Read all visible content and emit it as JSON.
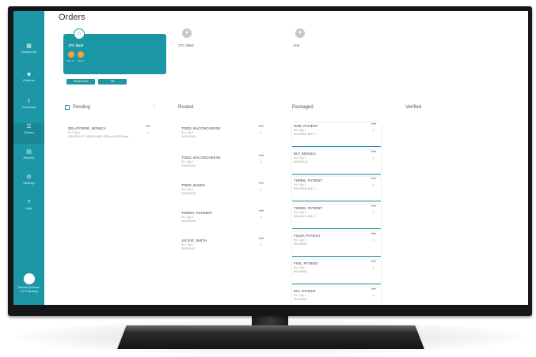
{
  "page": {
    "title": "Orders"
  },
  "nav": [
    {
      "icon": "dashboard-icon",
      "glyph": "▦",
      "label": "Dashboard"
    },
    {
      "icon": "patients-icon",
      "glyph": "☻",
      "label": "Patients"
    },
    {
      "icon": "pharmacy-icon",
      "glyph": "⚕",
      "label": "Pharmacy"
    },
    {
      "icon": "orders-icon",
      "glyph": "☰",
      "label": "Orders"
    },
    {
      "icon": "reports-icon",
      "glyph": "▤",
      "label": "Reports"
    },
    {
      "icon": "settings-icon",
      "glyph": "⚙",
      "label": "Settings"
    },
    {
      "icon": "help-icon",
      "glyph": "?",
      "label": "Help"
    }
  ],
  "profile": {
    "name": "Brenna Quintana",
    "org": "JTC Pharmacy"
  },
  "groups": [
    {
      "name": "JTC East",
      "icon": "group-icon",
      "selected": true
    },
    {
      "name": "JTC West",
      "icon": "group-icon",
      "selected": false
    },
    {
      "name": "test",
      "icon": "group-icon",
      "selected": false
    }
  ],
  "group_card": {
    "members": [
      "Jolie C",
      "Alex J"
    ],
    "buttons": [
      "Shared Cart",
      "Fill"
    ]
  },
  "columns": {
    "pending": {
      "title": "Pending",
      "orders": [
        {
          "patient": "DELATORRE, MONICA",
          "meta": "Rx 1   Qty 1",
          "rx": "0034759 1067 3469993 6482 4890 brd 3457393aab"
        }
      ]
    },
    "routed": {
      "title": "Routed",
      "orders": [
        {
          "patient": "TODD, BACONCHEESE",
          "meta": "Rx 1   Qty 1",
          "rx": "0000000043"
        },
        {
          "patient": "TODD, BACONCHEESE",
          "meta": "Rx 1   Qty 1",
          "rx": "0000000044"
        },
        {
          "patient": "TODD, BAKES",
          "meta": "Rx 1   Qty 1",
          "rx": "0000000028"
        },
        {
          "patient": "TOMMY, SCHMIDT",
          "meta": "Rx 1   Qty 1",
          "rx": "0000000009"
        },
        {
          "patient": "JACKIE, SMITH",
          "meta": "Rx 1   Qty 1",
          "rx": "0000000017"
        }
      ]
    },
    "packaged": {
      "title": "Packaged",
      "orders": [
        {
          "patient": "ONE, PATIENT",
          "meta": "Rx 1   Qty 1",
          "rx": "B00000687 8847-1"
        },
        {
          "patient": "DLT, MONICA",
          "meta": "Rx 1   Qty 1",
          "rx": "B00000013"
        },
        {
          "patient": "THREE, PATIENT",
          "meta": "Rx 1   Qty 1",
          "rx": "B00000693 8847-1"
        },
        {
          "patient": "THREE, PATIENT",
          "meta": "Rx 1   Qty 1",
          "rx": "B00000694 8847-2"
        },
        {
          "patient": "FOUR, PATIENT",
          "meta": "Rx 1   Qty 1",
          "rx": "B00000880"
        },
        {
          "patient": "FIVE, PATIENT",
          "meta": "Rx 1   Qty 1",
          "rx": "B00000881"
        },
        {
          "patient": "SIX, PATIENT",
          "meta": "Rx 1   Qty 1",
          "rx": "B00000882"
        }
      ]
    },
    "verified": {
      "title": "Verified"
    }
  },
  "card_actions": {
    "more": "•••",
    "status": "◷"
  },
  "colors": {
    "accent": "#1b96a5",
    "warning": "#f2a23a",
    "sidebar": "#1d97a6"
  }
}
